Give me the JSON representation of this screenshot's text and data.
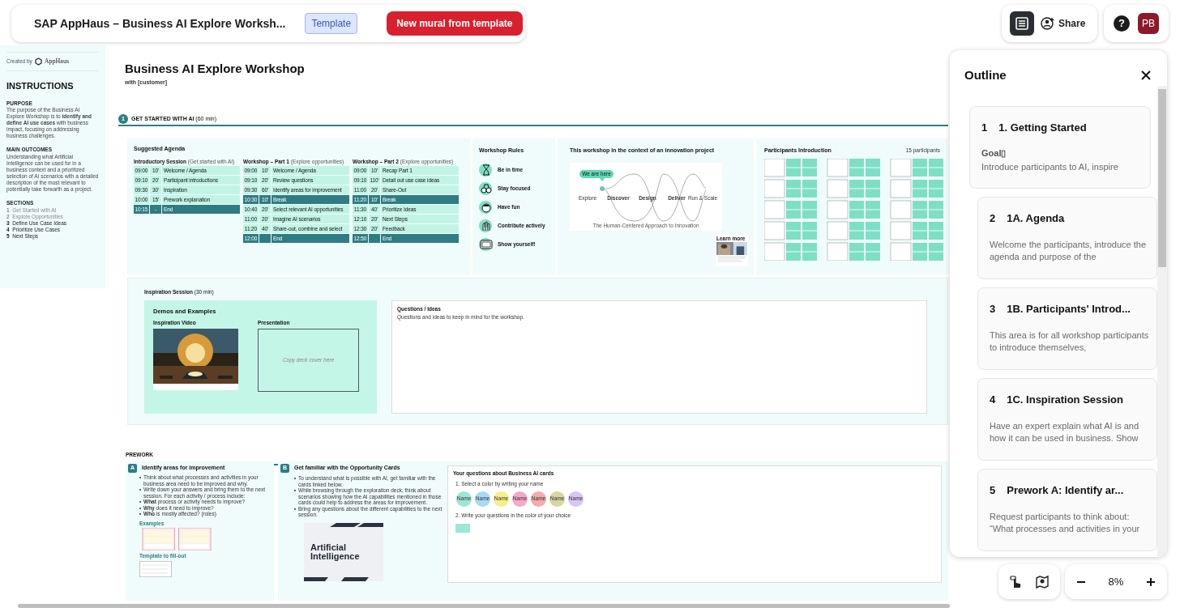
{
  "topbar": {
    "title": "SAP AppHaus – Business AI Explore Worksh...",
    "badge": "Template",
    "primary_button": "New mural from template",
    "share_button": "Share",
    "help": "?",
    "avatar": "PB"
  },
  "instructions": {
    "created_by": "Created by",
    "brand": "AppHaus",
    "heading": "INSTRUCTIONS",
    "blocks": [
      {
        "title": "PURPOSE",
        "text": "The purpose of the Business AI Explore Workshop is to **identify and define AI use cases** with business impact, focusing on addressing business challenges."
      },
      {
        "title": "MAIN OUTCOMES",
        "text": "Understanding what Artificial Intelligence can be used for in a business context and a prioritized selection of AI scenarios with a detailed description of the most relevant to potentially take forwarth as a project."
      }
    ],
    "sections_title": "SECTIONS",
    "sections": [
      {
        "num": "1",
        "label": "Get Started with AI",
        "dimmed": true
      },
      {
        "num": "2",
        "label": "Explore Opportunities",
        "dimmed": true
      },
      {
        "num": "3",
        "label": "Define Use Case Ideas",
        "dimmed": false
      },
      {
        "num": "4",
        "label": "Prioritize Use Cases",
        "dimmed": false
      },
      {
        "num": "5",
        "label": "Next Steps",
        "dimmed": false
      }
    ]
  },
  "board": {
    "title": "Business AI Explore Workshop",
    "subtitle": "with [customer]"
  },
  "section": {
    "number": "1",
    "title": "GET STARTED WITH AI",
    "duration": "(60 min)"
  },
  "agenda": {
    "title": "Suggested Agenda",
    "sessions": [
      {
        "title": "Introductory Session",
        "note": "(Get started with AI)",
        "rows": [
          {
            "time": "09:00",
            "dur": "10'",
            "item": "Welcome / Agenda",
            "kind": "item"
          },
          {
            "time": "09:10",
            "dur": "20'",
            "item": "Participant introductions",
            "kind": "item"
          },
          {
            "time": "09:30",
            "dur": "30'",
            "item": "Inspiration",
            "kind": "item"
          },
          {
            "time": "10:00",
            "dur": "15'",
            "item": "Prework explanation",
            "kind": "item"
          },
          {
            "time": "10:15",
            "dur": "-",
            "item": "End",
            "kind": "end"
          }
        ]
      },
      {
        "title": "Workshop – Part 1",
        "note": "(Explore opportunities)",
        "rows": [
          {
            "time": "09:00",
            "dur": "10'",
            "item": "Welcome / Agenda",
            "kind": "item"
          },
          {
            "time": "09:10",
            "dur": "20'",
            "item": "Review questions",
            "kind": "item"
          },
          {
            "time": "09:30",
            "dur": "60'",
            "item": "Identify areas for improvement",
            "kind": "item"
          },
          {
            "time": "10:30",
            "dur": "10'",
            "item": "Break",
            "kind": "break"
          },
          {
            "time": "10:40",
            "dur": "20'",
            "item": "Select relevant AI opportunities",
            "kind": "item"
          },
          {
            "time": "11:00",
            "dur": "20'",
            "item": "Imagine AI scenarios",
            "kind": "item"
          },
          {
            "time": "11:20",
            "dur": "40'",
            "item": "Share-out, combine and select",
            "kind": "item"
          },
          {
            "time": "12:00",
            "item": "End",
            "kind": "end"
          }
        ]
      },
      {
        "title": "Workshop – Part 2",
        "note": "(Explore opportunities)",
        "rows": [
          {
            "time": "09:00",
            "dur": "10'",
            "item": "Recap Part 1",
            "kind": "item"
          },
          {
            "time": "09:10",
            "dur": "110'",
            "item": "Detail out use case ideas",
            "kind": "item"
          },
          {
            "time": "11:00",
            "dur": "20'",
            "item": "Share-Out",
            "kind": "item"
          },
          {
            "time": "11:20",
            "dur": "10'",
            "item": "Break",
            "kind": "break"
          },
          {
            "time": "11:30",
            "dur": "40'",
            "item": "Prioritize Ideas",
            "kind": "item"
          },
          {
            "time": "12:10",
            "dur": "20'",
            "item": "Next Steps",
            "kind": "item"
          },
          {
            "time": "12:30",
            "dur": "20'",
            "item": "Feedback",
            "kind": "item"
          },
          {
            "time": "12:50",
            "item": "End",
            "kind": "end"
          }
        ]
      }
    ]
  },
  "rules": {
    "title": "Workshop Rules",
    "items": [
      {
        "label": "Be in time",
        "kind": "hourglass"
      },
      {
        "label": "Stay focused",
        "kind": "binoculars"
      },
      {
        "label": "Have fun",
        "kind": "face"
      },
      {
        "label": "Contribute actively",
        "kind": "hands"
      },
      {
        "label": "Show yourself!",
        "kind": "screen"
      }
    ]
  },
  "context": {
    "title": "This workshop in the context of an innovation project",
    "here": "We are here",
    "phases": [
      "Explore",
      "Discover",
      "Design",
      "Deliver",
      "Run & Scale"
    ],
    "caption": "The Human-Centered Approach to Innovation",
    "learn_more": "Learn more"
  },
  "participants": {
    "title": "Participants Introduction",
    "count": "15 participants"
  },
  "inspiration": {
    "title": "Inspiration Session",
    "duration": "(30 min)",
    "demos_title": "Demos and Examples",
    "video_label": "Inspiration Video",
    "presentation_label": "Presentation",
    "presentation_placeholder": "Copy deck cover here",
    "questions_title": "Questions / Ideas",
    "questions_text": "Questions and ideas to keep in mind for the workshop."
  },
  "prework": {
    "title": "PREWORK",
    "a": {
      "letter": "A",
      "title": "Identify areas for improvement",
      "bullets": [
        "Think about what processes and activities in your business area need to be improved and why.",
        "Write down your answers and bring them to the next session. For each activity / process include:",
        "**What** process or activity needs to improve?",
        "**Why** does it need to improve?",
        "**Who** is mostly affected? (roles)"
      ],
      "examples": "Examples",
      "template": "Template to fill-out"
    },
    "b": {
      "letter": "B",
      "title": "Get familiar with the Opportunity Cards",
      "bullets": [
        "To understand what is possible with AI, get familiar with the cards linked below.",
        "While browsing through the exploration deck, think about scenarios showing how the AI capabilities mentioned in those cards could help to address the areas for improvement.",
        "Bring any questions about the different capabilities to the next session."
      ],
      "deck_title": "Artificial Intelligence"
    },
    "questions": {
      "title": "Your questions about Business AI cards",
      "step1": "1. Select a color by writing your name",
      "names": [
        {
          "label": "Name",
          "color": "#9ee6d6"
        },
        {
          "label": "Name",
          "color": "#a9d8f5"
        },
        {
          "label": "Name",
          "color": "#f6ee8a"
        },
        {
          "label": "Name",
          "color": "#f5a9c9"
        },
        {
          "label": "Name",
          "color": "#f4abab"
        },
        {
          "label": "Name",
          "color": "#d5d6a2"
        },
        {
          "label": "Name",
          "color": "#d8c5f6"
        }
      ],
      "step2": "2. Write your questions in the color of your choice"
    }
  },
  "outline": {
    "title": "Outline",
    "items": [
      {
        "num": "1",
        "title": "1. Getting Started",
        "lead": "Goal▯",
        "text": "Introduce participants to AI, inspire",
        "children": [
          {
            "num": "2",
            "title": "1A. Agenda",
            "text": "Welcome the participants, introduce the agenda and purpose of the"
          },
          {
            "num": "3",
            "title": "1B. Participants' Introd...",
            "text": "This area is for all workshop participants to introduce themselves,"
          },
          {
            "num": "4",
            "title": "1C. Inspiration Session",
            "text": "Have an expert explain what AI is and how it can be used in business. Show"
          },
          {
            "num": "5",
            "title": "Prework A: Identify ar...",
            "text": "Request participants to think about: “What processes and activities in your"
          }
        ]
      }
    ]
  },
  "zoom": {
    "level": "8%"
  }
}
